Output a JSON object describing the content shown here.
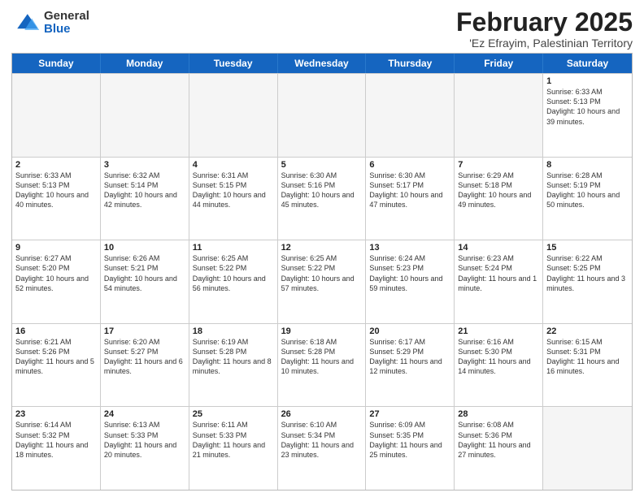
{
  "header": {
    "logo": {
      "general": "General",
      "blue": "Blue"
    },
    "title": "February 2025",
    "subtitle": "'Ez Efrayim, Palestinian Territory"
  },
  "weekdays": [
    "Sunday",
    "Monday",
    "Tuesday",
    "Wednesday",
    "Thursday",
    "Friday",
    "Saturday"
  ],
  "weeks": [
    [
      {
        "day": "",
        "info": "",
        "empty": true
      },
      {
        "day": "",
        "info": "",
        "empty": true
      },
      {
        "day": "",
        "info": "",
        "empty": true
      },
      {
        "day": "",
        "info": "",
        "empty": true
      },
      {
        "day": "",
        "info": "",
        "empty": true
      },
      {
        "day": "",
        "info": "",
        "empty": true
      },
      {
        "day": "1",
        "info": "Sunrise: 6:33 AM\nSunset: 5:13 PM\nDaylight: 10 hours\nand 39 minutes.",
        "empty": false
      }
    ],
    [
      {
        "day": "2",
        "info": "Sunrise: 6:33 AM\nSunset: 5:13 PM\nDaylight: 10 hours\nand 40 minutes.",
        "empty": false
      },
      {
        "day": "3",
        "info": "Sunrise: 6:32 AM\nSunset: 5:14 PM\nDaylight: 10 hours\nand 42 minutes.",
        "empty": false
      },
      {
        "day": "4",
        "info": "Sunrise: 6:31 AM\nSunset: 5:15 PM\nDaylight: 10 hours\nand 44 minutes.",
        "empty": false
      },
      {
        "day": "5",
        "info": "Sunrise: 6:30 AM\nSunset: 5:16 PM\nDaylight: 10 hours\nand 45 minutes.",
        "empty": false
      },
      {
        "day": "6",
        "info": "Sunrise: 6:30 AM\nSunset: 5:17 PM\nDaylight: 10 hours\nand 47 minutes.",
        "empty": false
      },
      {
        "day": "7",
        "info": "Sunrise: 6:29 AM\nSunset: 5:18 PM\nDaylight: 10 hours\nand 49 minutes.",
        "empty": false
      },
      {
        "day": "8",
        "info": "Sunrise: 6:28 AM\nSunset: 5:19 PM\nDaylight: 10 hours\nand 50 minutes.",
        "empty": false
      }
    ],
    [
      {
        "day": "9",
        "info": "Sunrise: 6:27 AM\nSunset: 5:20 PM\nDaylight: 10 hours\nand 52 minutes.",
        "empty": false
      },
      {
        "day": "10",
        "info": "Sunrise: 6:26 AM\nSunset: 5:21 PM\nDaylight: 10 hours\nand 54 minutes.",
        "empty": false
      },
      {
        "day": "11",
        "info": "Sunrise: 6:25 AM\nSunset: 5:22 PM\nDaylight: 10 hours\nand 56 minutes.",
        "empty": false
      },
      {
        "day": "12",
        "info": "Sunrise: 6:25 AM\nSunset: 5:22 PM\nDaylight: 10 hours\nand 57 minutes.",
        "empty": false
      },
      {
        "day": "13",
        "info": "Sunrise: 6:24 AM\nSunset: 5:23 PM\nDaylight: 10 hours\nand 59 minutes.",
        "empty": false
      },
      {
        "day": "14",
        "info": "Sunrise: 6:23 AM\nSunset: 5:24 PM\nDaylight: 11 hours\nand 1 minute.",
        "empty": false
      },
      {
        "day": "15",
        "info": "Sunrise: 6:22 AM\nSunset: 5:25 PM\nDaylight: 11 hours\nand 3 minutes.",
        "empty": false
      }
    ],
    [
      {
        "day": "16",
        "info": "Sunrise: 6:21 AM\nSunset: 5:26 PM\nDaylight: 11 hours\nand 5 minutes.",
        "empty": false
      },
      {
        "day": "17",
        "info": "Sunrise: 6:20 AM\nSunset: 5:27 PM\nDaylight: 11 hours\nand 6 minutes.",
        "empty": false
      },
      {
        "day": "18",
        "info": "Sunrise: 6:19 AM\nSunset: 5:28 PM\nDaylight: 11 hours\nand 8 minutes.",
        "empty": false
      },
      {
        "day": "19",
        "info": "Sunrise: 6:18 AM\nSunset: 5:28 PM\nDaylight: 11 hours\nand 10 minutes.",
        "empty": false
      },
      {
        "day": "20",
        "info": "Sunrise: 6:17 AM\nSunset: 5:29 PM\nDaylight: 11 hours\nand 12 minutes.",
        "empty": false
      },
      {
        "day": "21",
        "info": "Sunrise: 6:16 AM\nSunset: 5:30 PM\nDaylight: 11 hours\nand 14 minutes.",
        "empty": false
      },
      {
        "day": "22",
        "info": "Sunrise: 6:15 AM\nSunset: 5:31 PM\nDaylight: 11 hours\nand 16 minutes.",
        "empty": false
      }
    ],
    [
      {
        "day": "23",
        "info": "Sunrise: 6:14 AM\nSunset: 5:32 PM\nDaylight: 11 hours\nand 18 minutes.",
        "empty": false
      },
      {
        "day": "24",
        "info": "Sunrise: 6:13 AM\nSunset: 5:33 PM\nDaylight: 11 hours\nand 20 minutes.",
        "empty": false
      },
      {
        "day": "25",
        "info": "Sunrise: 6:11 AM\nSunset: 5:33 PM\nDaylight: 11 hours\nand 21 minutes.",
        "empty": false
      },
      {
        "day": "26",
        "info": "Sunrise: 6:10 AM\nSunset: 5:34 PM\nDaylight: 11 hours\nand 23 minutes.",
        "empty": false
      },
      {
        "day": "27",
        "info": "Sunrise: 6:09 AM\nSunset: 5:35 PM\nDaylight: 11 hours\nand 25 minutes.",
        "empty": false
      },
      {
        "day": "28",
        "info": "Sunrise: 6:08 AM\nSunset: 5:36 PM\nDaylight: 11 hours\nand 27 minutes.",
        "empty": false
      },
      {
        "day": "",
        "info": "",
        "empty": true
      }
    ]
  ]
}
